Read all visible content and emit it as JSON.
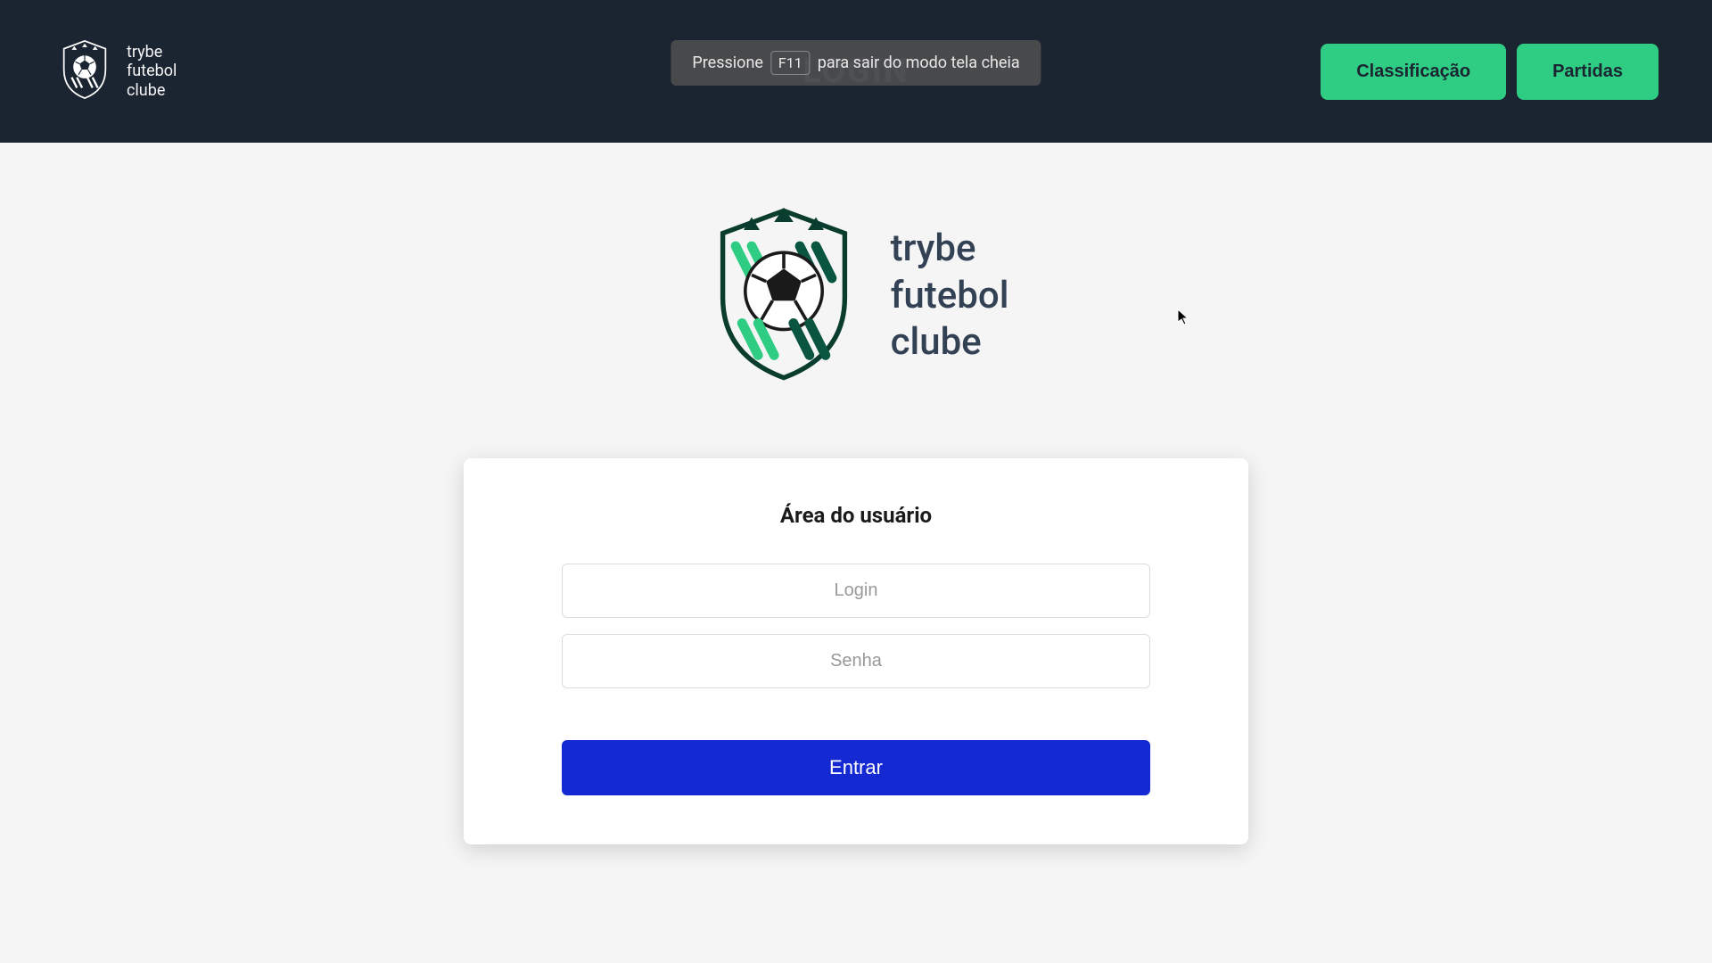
{
  "brand": {
    "line1": "trybe",
    "line2": "futebol",
    "line3": "clube"
  },
  "header": {
    "center_tab": "LOGIN",
    "nav": {
      "classificacao": "Classificação",
      "partidas": "Partidas"
    }
  },
  "fullscreen_notice": {
    "before": "Pressione",
    "key": "F11",
    "after": "para sair do modo tela cheia"
  },
  "login_card": {
    "title": "Área do usuário",
    "login_placeholder": "Login",
    "password_placeholder": "Senha",
    "submit_label": "Entrar"
  },
  "colors": {
    "header_bg": "#1b2531",
    "accent_green": "#2FCC84",
    "submit_blue": "#1429d1"
  }
}
